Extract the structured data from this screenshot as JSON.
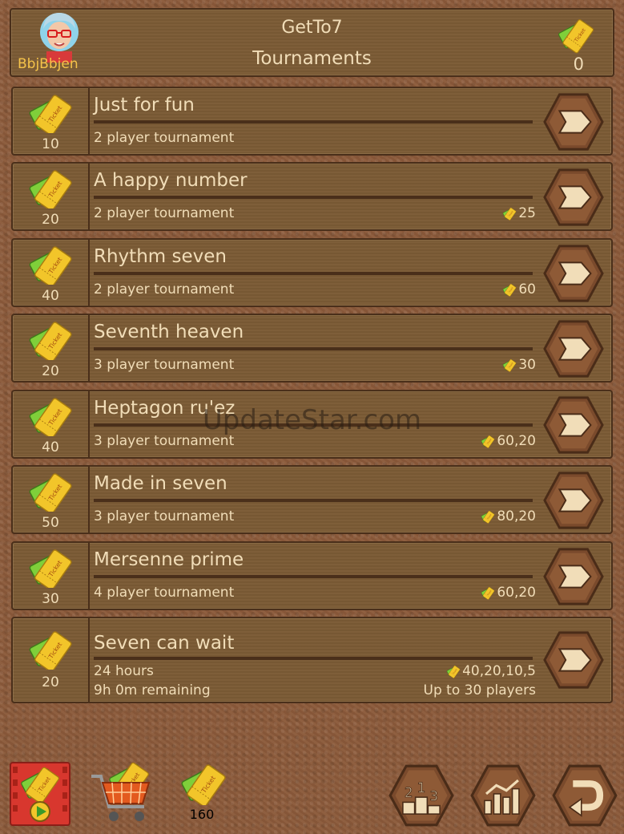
{
  "header": {
    "app_title": "GetTo7",
    "screen_title": "Tournaments",
    "username": "BbjBbjen",
    "tickets": "0"
  },
  "tournaments": [
    {
      "name": "Just for fun",
      "cost": "10",
      "type": "2 player tournament",
      "prize": ""
    },
    {
      "name": "A happy number",
      "cost": "20",
      "type": "2 player tournament",
      "prize": "25"
    },
    {
      "name": "Rhythm seven",
      "cost": "40",
      "type": "2 player tournament",
      "prize": "60"
    },
    {
      "name": "Seventh heaven",
      "cost": "20",
      "type": "3 player tournament",
      "prize": "30"
    },
    {
      "name": "Heptagon ru'ez",
      "cost": "40",
      "type": "3 player tournament",
      "prize": "60,20"
    },
    {
      "name": "Made in seven",
      "cost": "50",
      "type": "3 player tournament",
      "prize": "80,20"
    },
    {
      "name": "Mersenne prime",
      "cost": "30",
      "type": "4 player tournament",
      "prize": "60,20"
    },
    {
      "name": "Seven can wait",
      "cost": "20",
      "type": "24 hours",
      "prize": "40,20,10,5",
      "remaining": "9h 0m remaining",
      "capacity": "Up to 30 players"
    }
  ],
  "footer": {
    "ticket_balance": "160"
  },
  "watermark": "UpdateStar.com",
  "icons": [
    "avatar",
    "ticket-icon",
    "next-arrow-icon",
    "video-ticket-icon",
    "shop-cart-icon",
    "leaderboard-icon",
    "stats-icon",
    "back-icon"
  ],
  "colors": {
    "panel": "#7b5b35",
    "border": "#4a2f1a",
    "text": "#f1ddb8",
    "username": "#f5c34a",
    "ticket_green": "#7fcf3a",
    "ticket_yellow": "#f2c52a"
  }
}
